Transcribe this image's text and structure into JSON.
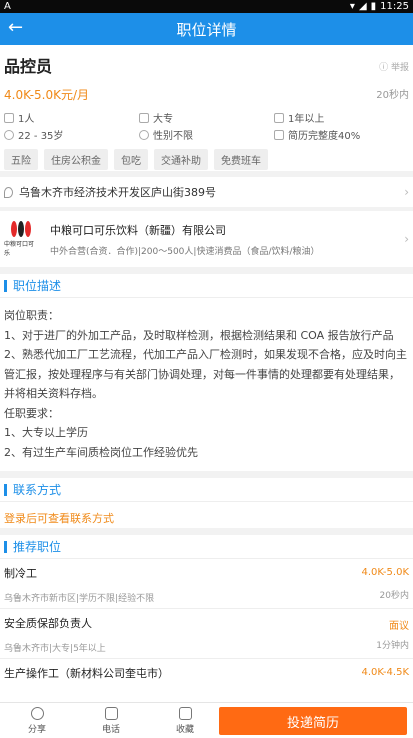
{
  "status_bar": {
    "time": "11:25",
    "left_label": "A"
  },
  "nav": {
    "back_icon": "←",
    "title": "职位详情"
  },
  "job": {
    "title": "品控员",
    "report_label": "举报",
    "salary": "4.0K-5.0K元/月",
    "posted": "20秒内",
    "attributes": [
      "1人",
      "大专",
      "1年以上",
      "22 - 35岁",
      "性别不限",
      "简历完整度40%"
    ],
    "tags": [
      "五险",
      "住房公积金",
      "包吃",
      "交通补助",
      "免费班车"
    ]
  },
  "address": "乌鲁木齐市经济技术开发区庐山街389号",
  "company": {
    "logo_text": "中粮可口可乐",
    "name": "中粮可口可乐饮料（新疆）有限公司",
    "info": "中外合营(合资．合作)|200～500人|快速消费品（食品/饮料/粮油）"
  },
  "description": {
    "section_title": "职位描述",
    "lines": [
      "岗位职责：",
      "1、对于进厂的外加工产品，及时取样检测，根据检测结果和 COA 报告放行产品",
      "2、熟悉代加工厂工艺流程，代加工产品入厂检测时，如果发现不合格，应及时向主管汇报，按处理程序与有关部门协调处理，对每一件事情的处理都要有处理结果，并将相关资料存档。",
      "任职要求：",
      "1、大专以上学历",
      "2、有过生产车间质检岗位工作经验优先"
    ]
  },
  "contact": {
    "section_title": "联系方式",
    "login_prompt": "登录后可查看联系方式"
  },
  "recommended": {
    "section_title": "推荐职位",
    "items": [
      {
        "title": "制冷工",
        "pay": "4.0K-5.0K",
        "meta": "乌鲁木齐市新市区|学历不限|经验不限",
        "time": "20秒内"
      },
      {
        "title": "安全质保部负责人",
        "pay": "面议",
        "meta": "乌鲁木齐市|大专|5年以上",
        "time": "1分钟内"
      },
      {
        "title": "生产操作工（新材料公司奎屯市）",
        "pay": "4.0K-4.5K",
        "meta": "",
        "time": ""
      }
    ]
  },
  "bottom_bar": {
    "share": "分享",
    "phone": "电话",
    "favorite": "收藏",
    "submit": "投递简历"
  }
}
